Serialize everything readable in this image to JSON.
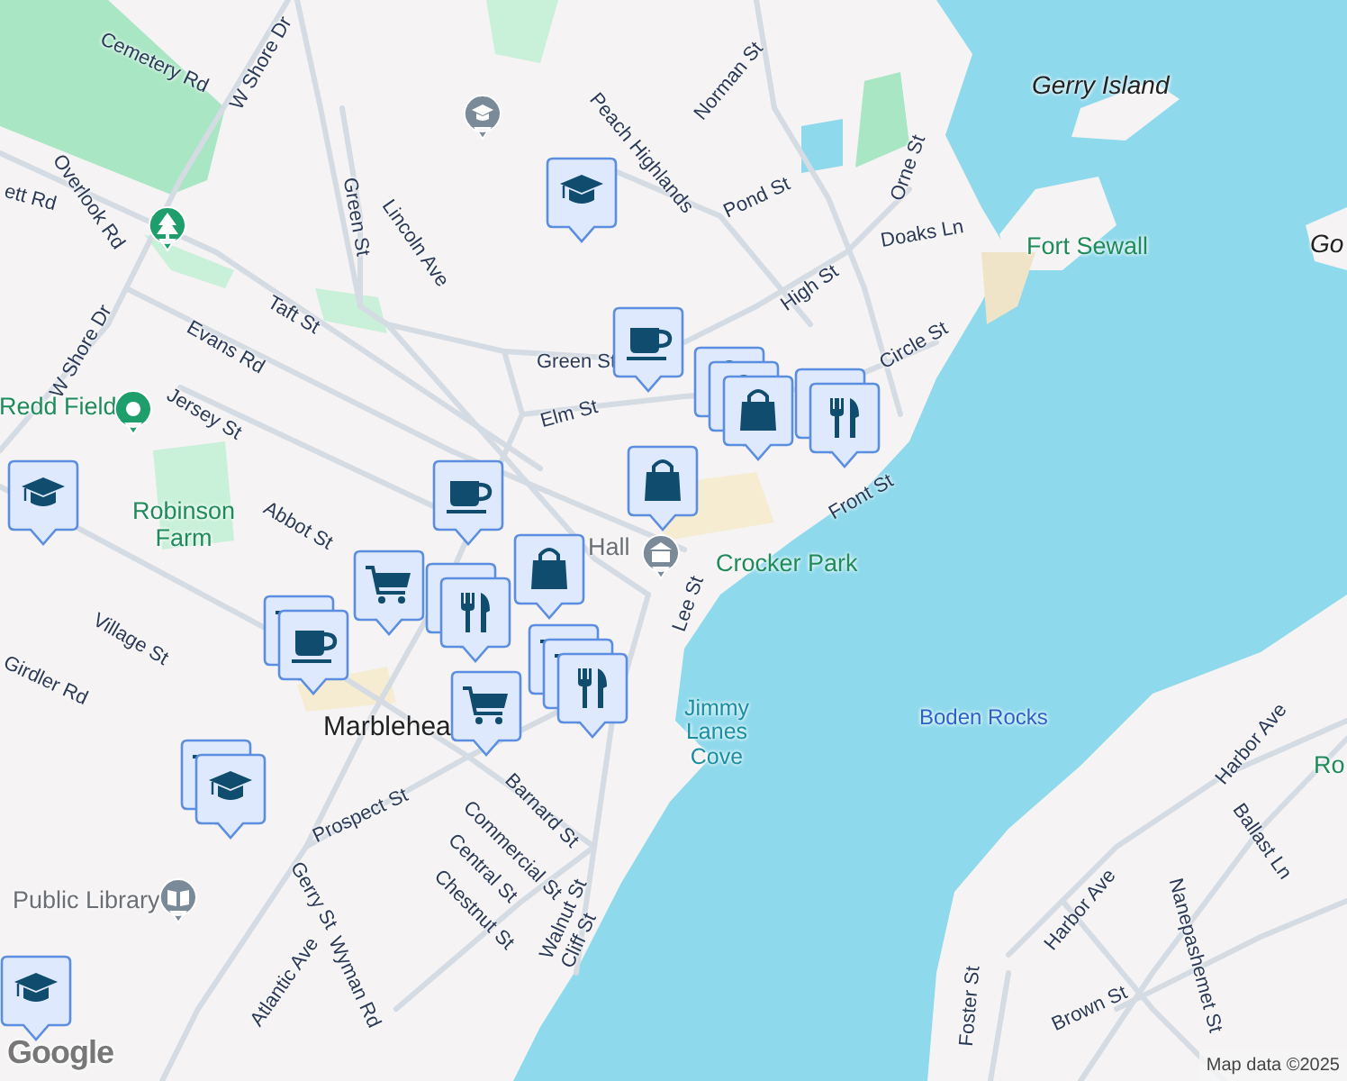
{
  "map_labels": [
    {
      "text": "Cemetery Rd",
      "kind": "street"
    },
    {
      "text": "W Shore Dr",
      "kind": "street"
    },
    {
      "text": "Norman St",
      "kind": "street"
    },
    {
      "text": "Gerry Island",
      "kind": "island"
    },
    {
      "text": "Peach Highlands",
      "kind": "street"
    },
    {
      "text": "Orne St",
      "kind": "street"
    },
    {
      "text": "ett Rd",
      "kind": "street"
    },
    {
      "text": "Overlook Rd",
      "kind": "street"
    },
    {
      "text": "Green St",
      "kind": "street"
    },
    {
      "text": "Lincoln Ave",
      "kind": "street"
    },
    {
      "text": "Pond St",
      "kind": "street"
    },
    {
      "text": "Doaks Ln",
      "kind": "street"
    },
    {
      "text": "Fort Sewall",
      "kind": "park"
    },
    {
      "text": "Go",
      "kind": "island"
    },
    {
      "text": "High St",
      "kind": "street"
    },
    {
      "text": "W Shore Dr",
      "kind": "street"
    },
    {
      "text": "Evans Rd",
      "kind": "street"
    },
    {
      "text": "Taft St",
      "kind": "street"
    },
    {
      "text": "Green St",
      "kind": "street"
    },
    {
      "text": "Circle St",
      "kind": "street"
    },
    {
      "text": "Redd Field",
      "kind": "park"
    },
    {
      "text": "Jersey St",
      "kind": "street"
    },
    {
      "text": "Elm St",
      "kind": "street"
    },
    {
      "text": "Front St",
      "kind": "street"
    },
    {
      "text": "Robinson Farm",
      "kind": "park"
    },
    {
      "text": "Abbot St",
      "kind": "street"
    },
    {
      "text": "Hall",
      "kind": "poi"
    },
    {
      "text": "Crocker Park",
      "kind": "park"
    },
    {
      "text": "Lee St",
      "kind": "street"
    },
    {
      "text": "Village St",
      "kind": "street"
    },
    {
      "text": "Girdler Rd",
      "kind": "street"
    },
    {
      "text": "Marblehea",
      "kind": "town"
    },
    {
      "text": "Jimmy Lanes Cove",
      "kind": "water"
    },
    {
      "text": "Boden Rocks",
      "kind": "rocks"
    },
    {
      "text": "Harbor Ave",
      "kind": "street"
    },
    {
      "text": "Ro",
      "kind": "park"
    },
    {
      "text": "Prospect St",
      "kind": "street"
    },
    {
      "text": "Commercial St",
      "kind": "street"
    },
    {
      "text": "Barnard St",
      "kind": "street"
    },
    {
      "text": "Ballast Ln",
      "kind": "street"
    },
    {
      "text": "Public Library",
      "kind": "poi"
    },
    {
      "text": "Gerry St",
      "kind": "street"
    },
    {
      "text": "Central St",
      "kind": "street"
    },
    {
      "text": "Chestnut St",
      "kind": "street"
    },
    {
      "text": "Walnut St",
      "kind": "street"
    },
    {
      "text": "Cliff St",
      "kind": "street"
    },
    {
      "text": "Harbor Ave",
      "kind": "street"
    },
    {
      "text": "Atlantic Ave",
      "kind": "street"
    },
    {
      "text": "Wyman Rd",
      "kind": "street"
    },
    {
      "text": "Foster St",
      "kind": "street"
    },
    {
      "text": "Brown St",
      "kind": "street"
    },
    {
      "text": "Nanepashemet St",
      "kind": "street"
    }
  ],
  "markers": [
    {
      "kind": "school"
    },
    {
      "kind": "cafe"
    },
    {
      "kind": "shopping",
      "behind": [
        {
          "kind": "shopping"
        },
        {
          "kind": "shopping"
        }
      ]
    },
    {
      "kind": "restaurant",
      "behind": [
        {
          "kind": "restaurant"
        }
      ]
    },
    {
      "kind": "shopping"
    },
    {
      "kind": "school"
    },
    {
      "kind": "cafe"
    },
    {
      "kind": "shopping"
    },
    {
      "kind": "grocery"
    },
    {
      "kind": "restaurant",
      "behind": [
        {
          "kind": "restaurant"
        }
      ]
    },
    {
      "kind": "cafe",
      "behind": [
        {
          "kind": "grocery"
        }
      ]
    },
    {
      "kind": "restaurant",
      "behind": [
        {
          "kind": "grocery"
        },
        {
          "kind": "grocery"
        }
      ]
    },
    {
      "kind": "grocery"
    },
    {
      "kind": "school",
      "behind": [
        {
          "kind": "grocery"
        }
      ]
    },
    {
      "kind": "school"
    }
  ],
  "logo": "Google",
  "attribution": "Map data ©2025"
}
